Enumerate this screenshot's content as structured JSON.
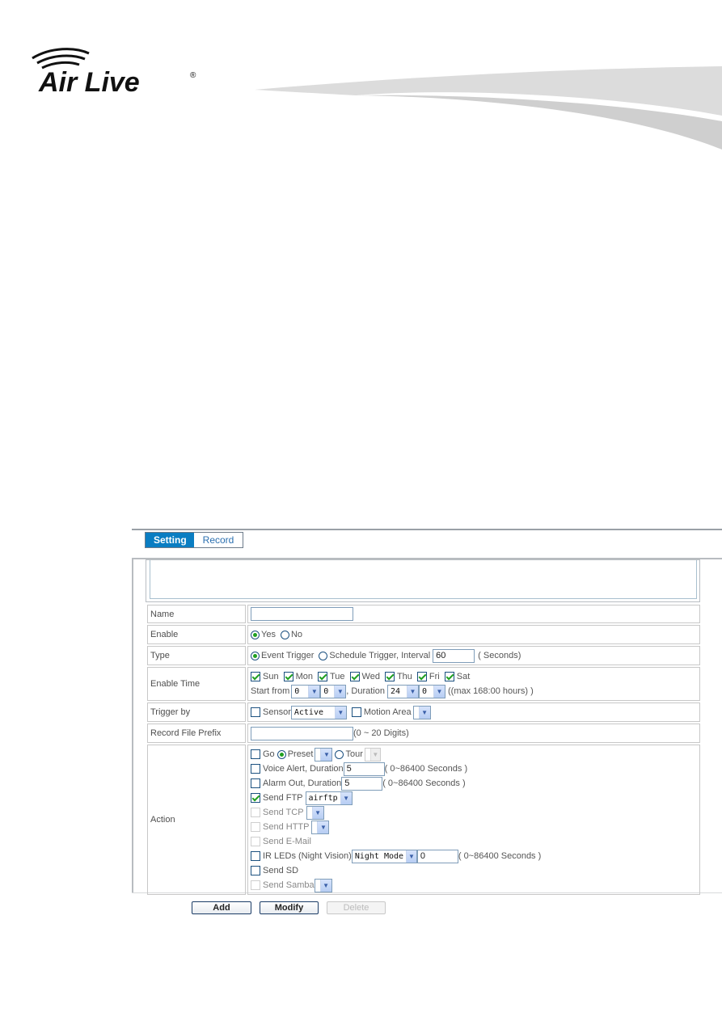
{
  "brand": {
    "logo_text": "Air Live",
    "registered_mark": "®"
  },
  "tabs": [
    {
      "label": "Setting",
      "active": true
    },
    {
      "label": "Record",
      "active": false
    }
  ],
  "form": {
    "name": {
      "label": "Name",
      "value": ""
    },
    "enable": {
      "label": "Enable",
      "options": [
        "Yes",
        "No"
      ],
      "selected": "Yes"
    },
    "type": {
      "label": "Type",
      "options": [
        "Event Trigger",
        "Schedule Trigger, Interval"
      ],
      "selected": "Event Trigger",
      "interval_value": "60",
      "interval_unit": "( Seconds)"
    },
    "enable_time": {
      "label": "Enable Time",
      "days": [
        {
          "label": "Sun",
          "checked": true
        },
        {
          "label": "Mon",
          "checked": true
        },
        {
          "label": "Tue",
          "checked": true
        },
        {
          "label": "Wed",
          "checked": true
        },
        {
          "label": "Thu",
          "checked": true
        },
        {
          "label": "Fri",
          "checked": true
        },
        {
          "label": "Sat",
          "checked": true
        }
      ],
      "start_from_label": "Start from",
      "start_hour": "0",
      "start_minute": "0",
      "duration_label": ", Duration",
      "duration_hour": "24",
      "duration_minute": "0",
      "max_note": "((max 168:00 hours) )"
    },
    "trigger_by": {
      "label": "Trigger by",
      "sensor_label": "Sensor",
      "sensor_checked": false,
      "sensor_value": "Active",
      "motion_label": "Motion Area",
      "motion_checked": false,
      "motion_value": ""
    },
    "record_prefix": {
      "label": "Record File Prefix",
      "value": "",
      "note": "(0 ~ 20 Digits)"
    },
    "action": {
      "label": "Action",
      "go": {
        "label": "Go",
        "checked": false,
        "preset_label": "Preset",
        "tour_label": "Tour",
        "selected": "Preset"
      },
      "voice_alert": {
        "label": "Voice Alert, Duration",
        "checked": false,
        "value": "5",
        "note": "( 0~86400 Seconds )"
      },
      "alarm_out": {
        "label": "Alarm Out, Duration",
        "checked": false,
        "value": "5",
        "note": "( 0~86400 Seconds )"
      },
      "send_ftp": {
        "label": "Send FTP",
        "checked": true,
        "value": "airftp"
      },
      "send_tcp": {
        "label": "Send TCP",
        "checked": false,
        "value": ""
      },
      "send_http": {
        "label": "Send HTTP",
        "checked": false,
        "value": ""
      },
      "send_email": {
        "label": "Send E-Mail",
        "checked": false
      },
      "ir_leds": {
        "label": "IR LEDs (Night Vision)",
        "checked": false,
        "mode": "Night Mode",
        "value": "0",
        "note": "( 0~86400 Seconds )"
      },
      "send_sd": {
        "label": "Send SD",
        "checked": false
      },
      "send_samba": {
        "label": "Send Samba",
        "checked": false,
        "value": ""
      }
    }
  },
  "buttons": {
    "add": "Add",
    "modify": "Modify",
    "delete": "Delete"
  },
  "colors": {
    "tab_active_bg": "#0a7dc2",
    "check_green": "#21a121",
    "input_border": "#7f9db9"
  }
}
